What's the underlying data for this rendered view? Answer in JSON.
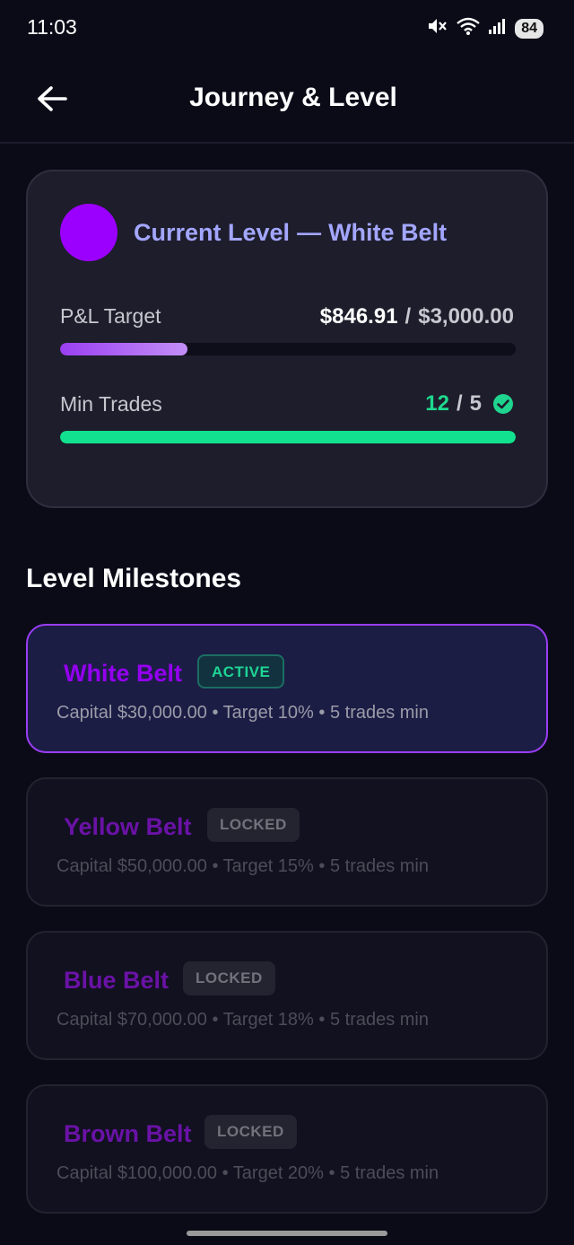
{
  "status_bar": {
    "time": "11:03",
    "battery": "84"
  },
  "header": {
    "title": "Journey & Level"
  },
  "current_level": {
    "prefix": "Current Level",
    "separator": "—",
    "name": "White Belt",
    "pnl": {
      "label": "P&L Target",
      "current": "$846.91",
      "slash": "/",
      "target": "$3,000.00",
      "progress": 0.279
    },
    "trades": {
      "label": "Min Trades",
      "count": "12",
      "slash": "/",
      "min": "5",
      "progress": 1.0
    }
  },
  "milestones": {
    "title": "Level Milestones",
    "items": [
      {
        "name": "White Belt",
        "badge": "ACTIVE",
        "details": "Capital $30,000.00 • Target 10% • 5 trades min"
      },
      {
        "name": "Yellow Belt",
        "badge": "LOCKED",
        "details": "Capital $50,000.00 • Target 15% • 5 trades min"
      },
      {
        "name": "Blue Belt",
        "badge": "LOCKED",
        "details": "Capital $70,000.00 • Target 18% • 5 trades min"
      },
      {
        "name": "Brown Belt",
        "badge": "LOCKED",
        "details": "Capital $100,000.00 • Target 20% • 5 trades min"
      }
    ]
  },
  "colors": {
    "accent_purple": "#9b00ff",
    "success_green": "#12e28f",
    "heading_lavender": "#a3a6ff"
  }
}
